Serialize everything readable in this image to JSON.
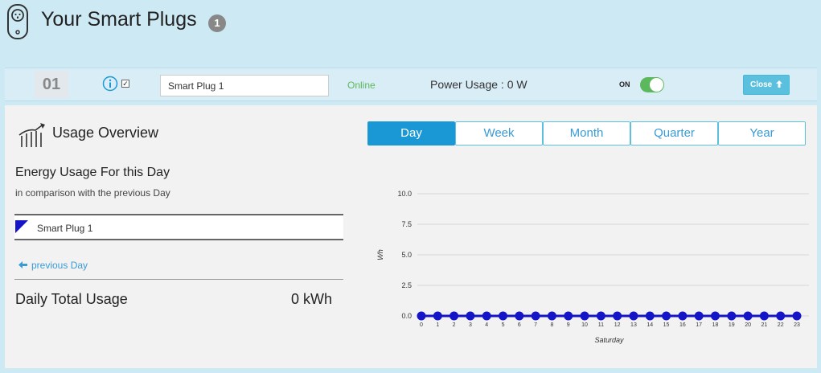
{
  "header": {
    "title": "Your Smart Plugs",
    "count": "1"
  },
  "plug": {
    "number": "01",
    "name": "Smart Plug 1",
    "status": "Online",
    "power_usage": "Power Usage : 0 W",
    "power_state_label": "ON",
    "power_on": true,
    "selected": true,
    "close_label": "Close"
  },
  "overview": {
    "title": "Usage Overview",
    "energy_heading": "Energy Usage For this Day",
    "energy_subheading": "in comparison with the previous Day",
    "legend_label": "Smart Plug 1",
    "previous_link": "previous Day",
    "daily_total_label": "Daily Total Usage",
    "daily_total_value": "0 kWh"
  },
  "period_tabs": [
    {
      "label": "Day",
      "active": true
    },
    {
      "label": "Week",
      "active": false
    },
    {
      "label": "Month",
      "active": false
    },
    {
      "label": "Quarter",
      "active": false
    },
    {
      "label": "Year",
      "active": false
    }
  ],
  "colors": {
    "background": "#cde9f4",
    "accent": "#1a98d6",
    "online": "#5cb85c",
    "series": "#1515c8",
    "close_button": "#5bc0de"
  },
  "icons": {
    "logo": "smart-plug-icon",
    "info": "info-icon",
    "usage": "usage-meter-icon",
    "previous": "arrow-left-icon",
    "close": "arrow-up-icon"
  },
  "chart_data": {
    "type": "line",
    "x": [
      0,
      1,
      2,
      3,
      4,
      5,
      6,
      7,
      8,
      9,
      10,
      11,
      12,
      13,
      14,
      15,
      16,
      17,
      18,
      19,
      20,
      21,
      22,
      23
    ],
    "series": [
      {
        "name": "Smart Plug 1",
        "values": [
          0,
          0,
          0,
          0,
          0,
          0,
          0,
          0,
          0,
          0,
          0,
          0,
          0,
          0,
          0,
          0,
          0,
          0,
          0,
          0,
          0,
          0,
          0,
          0
        ]
      }
    ],
    "title": "",
    "xlabel": "Saturday",
    "ylabel": "Wh",
    "ylim": [
      0,
      10
    ],
    "yticks": [
      "10.0",
      "7.5",
      "5.0",
      "2.5",
      "0.0"
    ],
    "grid": true
  }
}
